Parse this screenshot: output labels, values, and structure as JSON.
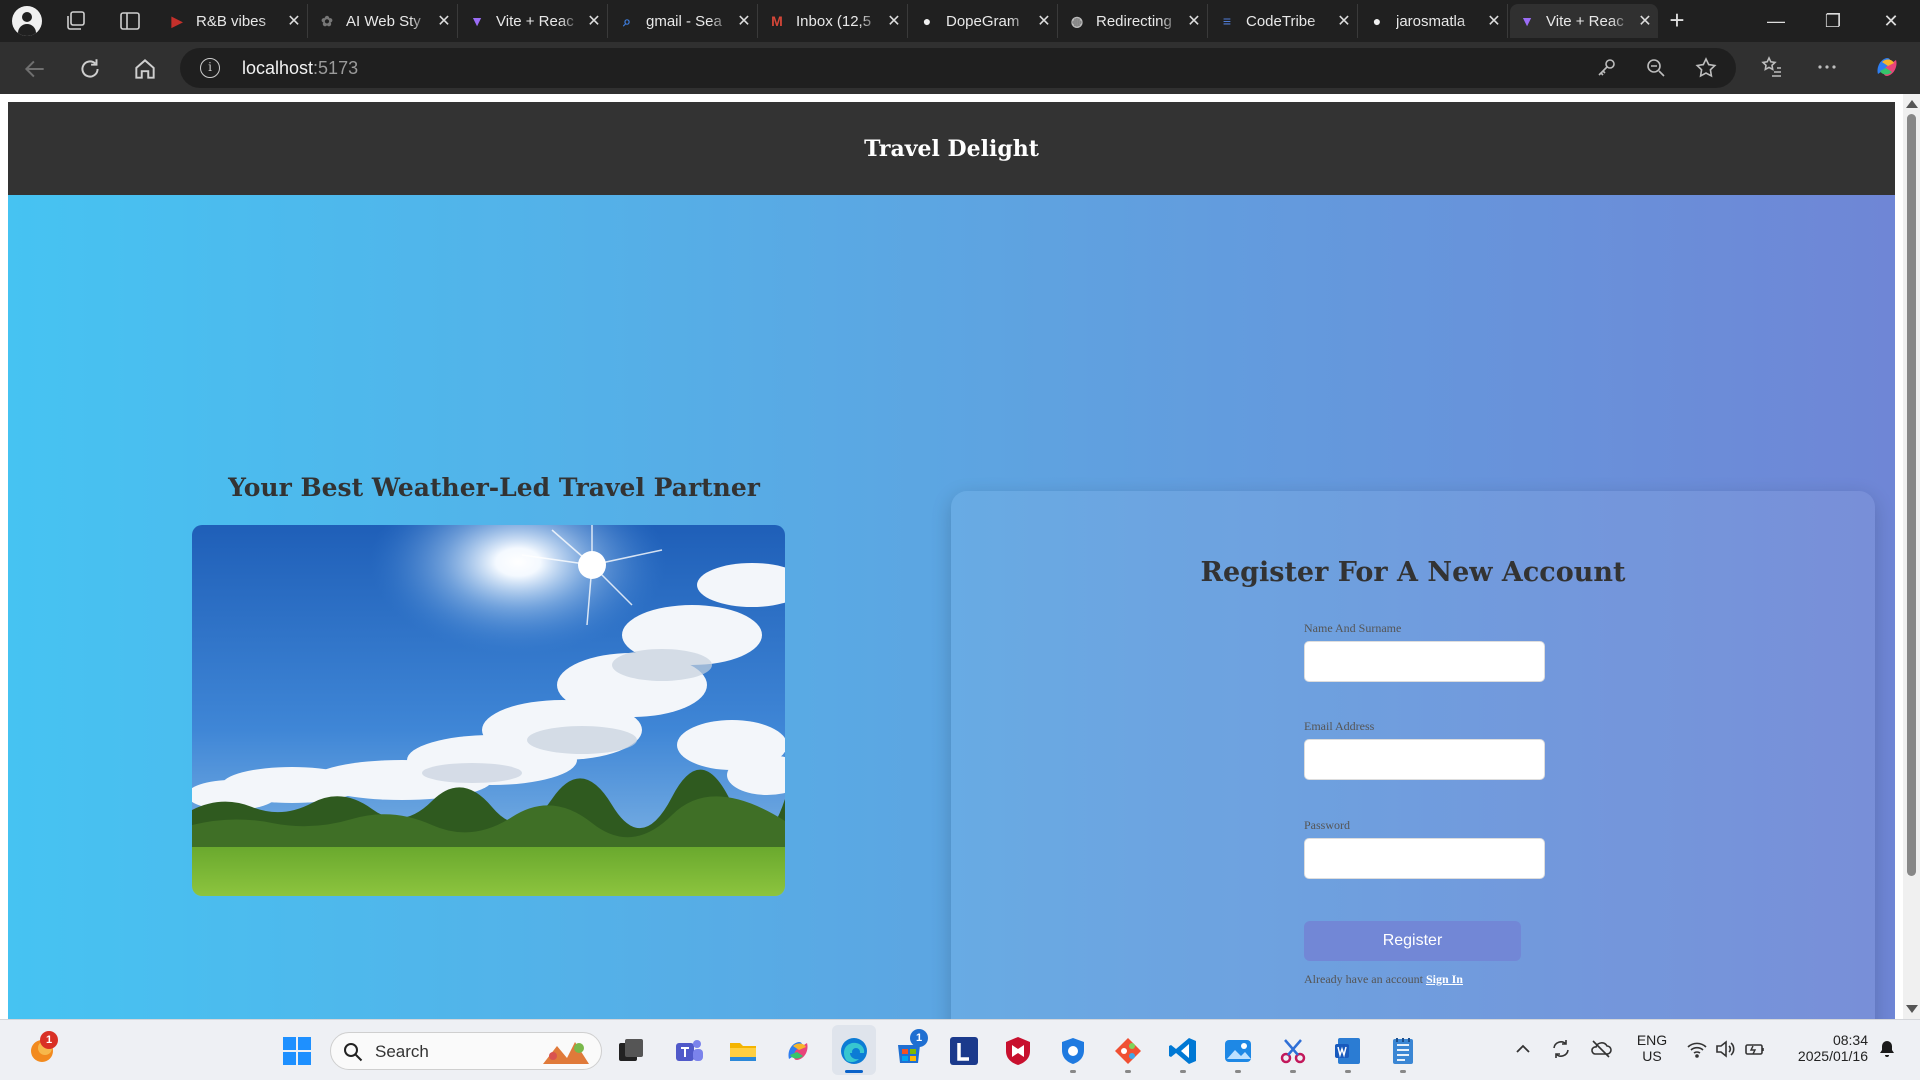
{
  "browser": {
    "tabs": [
      {
        "title": "R&B vibes",
        "icon": "youtube-icon",
        "color": "#c4302b"
      },
      {
        "title": "AI Web Sty",
        "icon": "openai-icon",
        "color": "#777777"
      },
      {
        "title": "Vite + Reac",
        "icon": "vite-icon",
        "color": "#9b6cf6"
      },
      {
        "title": "gmail - Sea",
        "icon": "search-icon",
        "color": "#3d7bd9"
      },
      {
        "title": "Inbox (12,5",
        "icon": "gmail-icon",
        "color": "#d44638"
      },
      {
        "title": "DopeGram",
        "icon": "github-icon",
        "color": "#f0f0f0"
      },
      {
        "title": "Redirecting",
        "icon": "globe-icon",
        "color": "#bbbbbb"
      },
      {
        "title": "CodeTribe",
        "icon": "document-icon",
        "color": "#4f7cd8"
      },
      {
        "title": "jarosmatla",
        "icon": "github-icon",
        "color": "#f0f0f0"
      },
      {
        "title": "Vite + Reac",
        "icon": "vite-icon",
        "color": "#9b6cf6",
        "active": true
      }
    ],
    "tab_close_glyph": "✕",
    "new_tab_glyph": "+",
    "window_controls": {
      "minimize": "—",
      "restore": "❐",
      "close": "✕"
    },
    "url": {
      "host": "localhost",
      "port": ":5173"
    },
    "url_info_glyph": "i"
  },
  "page": {
    "header_title": "Travel Delight",
    "left_title": "Your Best Weather-Led Travel Partner",
    "form": {
      "title": "Register For A New Account",
      "name_label": "Name And Surname",
      "name_value": "",
      "email_label": "Email Address",
      "email_value": "",
      "password_label": "Password",
      "password_value": "",
      "submit_label": "Register",
      "signin_prompt": "Already have an account",
      "signin_link": "Sign In"
    }
  },
  "taskbar": {
    "search_placeholder": "Search",
    "weather_badge": "1",
    "store_badge": "1",
    "lang_line1": "ENG",
    "lang_line2": "US",
    "time": "08:34",
    "date": "2025/01/16"
  },
  "colors": {
    "header_bg": "#333333",
    "hero_gradient_start": "#46c3f2",
    "hero_gradient_end": "#6f86d6",
    "register_button": "#7287d6",
    "heading_text": "#333333"
  }
}
